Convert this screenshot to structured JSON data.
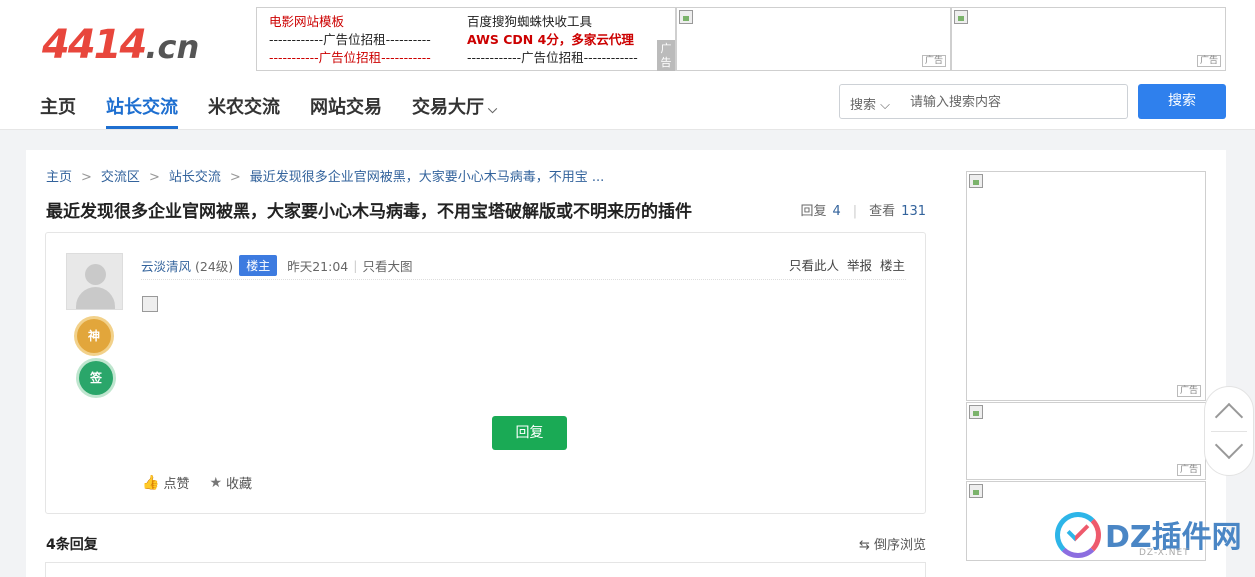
{
  "logo": {
    "main": "4414",
    "suffix": ".cn"
  },
  "ads": {
    "col1": [
      "电影网站模板",
      "------------广告位招租----------",
      "-----------广告位招租-----------"
    ],
    "col2": [
      "百度搜狗蜘蛛快收工具",
      "AWS CDN 4分，多家云代理",
      "------------广告位招租------------"
    ],
    "tag": "广告",
    "mini_tag": "广告"
  },
  "nav": {
    "items": [
      "主页",
      "站长交流",
      "米农交流",
      "网站交易",
      "交易大厅"
    ],
    "active_index": 1,
    "chevron": "chevron-down-icon"
  },
  "search": {
    "scope": "搜索",
    "placeholder": "请输入搜索内容",
    "button": "搜索"
  },
  "breadcrumb": {
    "items": [
      "主页",
      "交流区",
      "站长交流",
      "最近发现很多企业官网被黑，大家要小心木马病毒，不用宝 ..."
    ],
    "separator": ">"
  },
  "thread": {
    "title": "最近发现很多企业官网被黑，大家要小心木马病毒，不用宝塔破解版或不明来历的插件",
    "replies_label": "回复",
    "replies": "4",
    "views_label": "查看",
    "views": "131"
  },
  "post": {
    "username": "云淡清风",
    "level": "(24级)",
    "badge": "楼主",
    "time": "昨天21:04",
    "view_large": "只看大图",
    "medals": [
      "神",
      "签"
    ],
    "right_actions": [
      "只看此人",
      "举报",
      "楼主"
    ],
    "reply_button": "回复",
    "like": "点赞",
    "favorite": "收藏"
  },
  "replies_section": {
    "count": "4条回复",
    "order": "倒序浏览"
  },
  "watermark": {
    "text": "DZ插件网",
    "sub": "DZ-X.NET"
  },
  "colors": {
    "accent": "#2f80ed",
    "brand_red": "#e8463c",
    "green": "#1aaa55",
    "link": "#33639c"
  }
}
